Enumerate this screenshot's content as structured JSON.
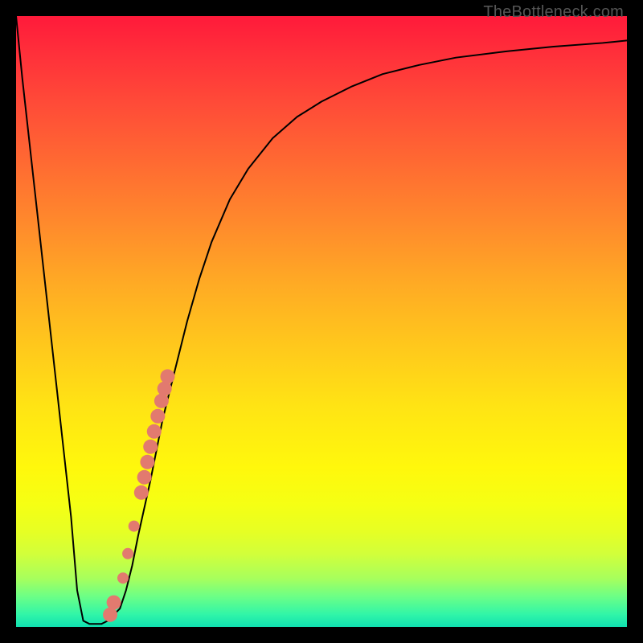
{
  "watermark": "TheBottleneck.com",
  "chart_data": {
    "type": "line",
    "title": "",
    "xlabel": "",
    "ylabel": "",
    "xlim": [
      0,
      100
    ],
    "ylim": [
      0,
      100
    ],
    "grid": false,
    "series": [
      {
        "name": "curve",
        "color": "#000000",
        "x": [
          0,
          1,
          3,
          5,
          7,
          9,
          10,
          11,
          12,
          13,
          14,
          15,
          17,
          18,
          19,
          20,
          22,
          24,
          26,
          28,
          30,
          32,
          35,
          38,
          42,
          46,
          50,
          55,
          60,
          66,
          72,
          80,
          88,
          96,
          100
        ],
        "values": [
          100,
          90,
          72,
          54,
          36,
          18,
          6,
          1,
          0.5,
          0.5,
          0.5,
          1,
          3,
          6,
          10,
          15,
          24,
          34,
          42,
          50,
          57,
          63,
          70,
          75,
          80,
          83.5,
          86,
          88.5,
          90.5,
          92,
          93.2,
          94.2,
          95,
          95.6,
          96
        ]
      }
    ],
    "highlight_points": {
      "name": "highlight-dots",
      "color": "#e27a6f",
      "radius_large": 9,
      "radius_small": 7,
      "points": [
        {
          "x": 15.4,
          "y": 2.0,
          "r": "large"
        },
        {
          "x": 16.0,
          "y": 4.0,
          "r": "large"
        },
        {
          "x": 17.5,
          "y": 8.0,
          "r": "small"
        },
        {
          "x": 18.3,
          "y": 12.0,
          "r": "small"
        },
        {
          "x": 19.3,
          "y": 16.5,
          "r": "small"
        },
        {
          "x": 20.5,
          "y": 22.0,
          "r": "large"
        },
        {
          "x": 21.0,
          "y": 24.5,
          "r": "large"
        },
        {
          "x": 21.5,
          "y": 27.0,
          "r": "large"
        },
        {
          "x": 22.0,
          "y": 29.5,
          "r": "large"
        },
        {
          "x": 22.6,
          "y": 32.0,
          "r": "large"
        },
        {
          "x": 23.2,
          "y": 34.5,
          "r": "large"
        },
        {
          "x": 23.8,
          "y": 37.0,
          "r": "large"
        },
        {
          "x": 24.3,
          "y": 39.0,
          "r": "large"
        },
        {
          "x": 24.8,
          "y": 41.0,
          "r": "large"
        }
      ]
    },
    "gradient_stops": [
      {
        "pos": 0,
        "color": "#ff1a3a"
      },
      {
        "pos": 50,
        "color": "#ffd018"
      },
      {
        "pos": 80,
        "color": "#fff80c"
      },
      {
        "pos": 100,
        "color": "#10e0b0"
      }
    ]
  }
}
